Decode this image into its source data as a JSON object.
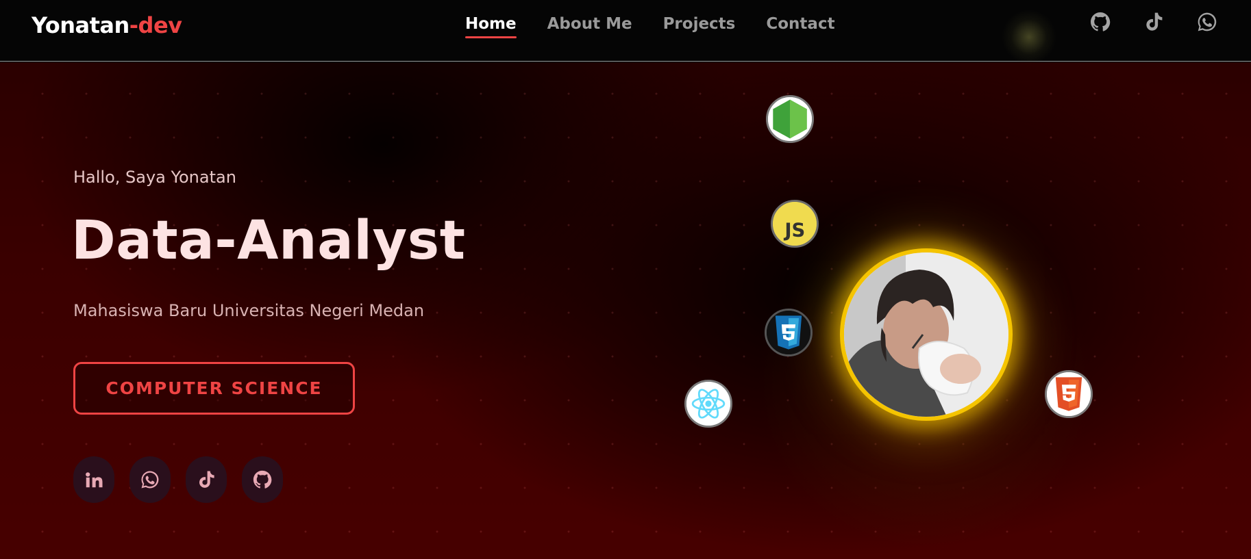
{
  "nav": {
    "logo_main": "Yonatan",
    "logo_accent": "-dev",
    "links": [
      {
        "label": "Home",
        "active": true
      },
      {
        "label": "About Me",
        "active": false
      },
      {
        "label": "Projects",
        "active": false
      },
      {
        "label": "Contact",
        "active": false
      }
    ],
    "icons": [
      "github-icon",
      "tiktok-icon",
      "whatsapp-icon"
    ]
  },
  "hero": {
    "greeting": "Hallo, Saya Yonatan",
    "headline": "Data-Analyst",
    "subtitle": "Mahasiswa Baru Universitas Negeri Medan",
    "cta_label": "COMPUTER SCIENCE",
    "socials": [
      "linkedin-icon",
      "whatsapp-icon",
      "tiktok-icon",
      "github-icon"
    ]
  },
  "tech_badges": [
    "nodejs-icon",
    "javascript-icon",
    "css3-icon",
    "react-icon",
    "html5-icon"
  ],
  "js_badge_text": "JS",
  "colors": {
    "accent": "#ef4444",
    "avatar_ring": "#f5c400",
    "background_dark": "#050505",
    "hero_red": "#470000"
  }
}
